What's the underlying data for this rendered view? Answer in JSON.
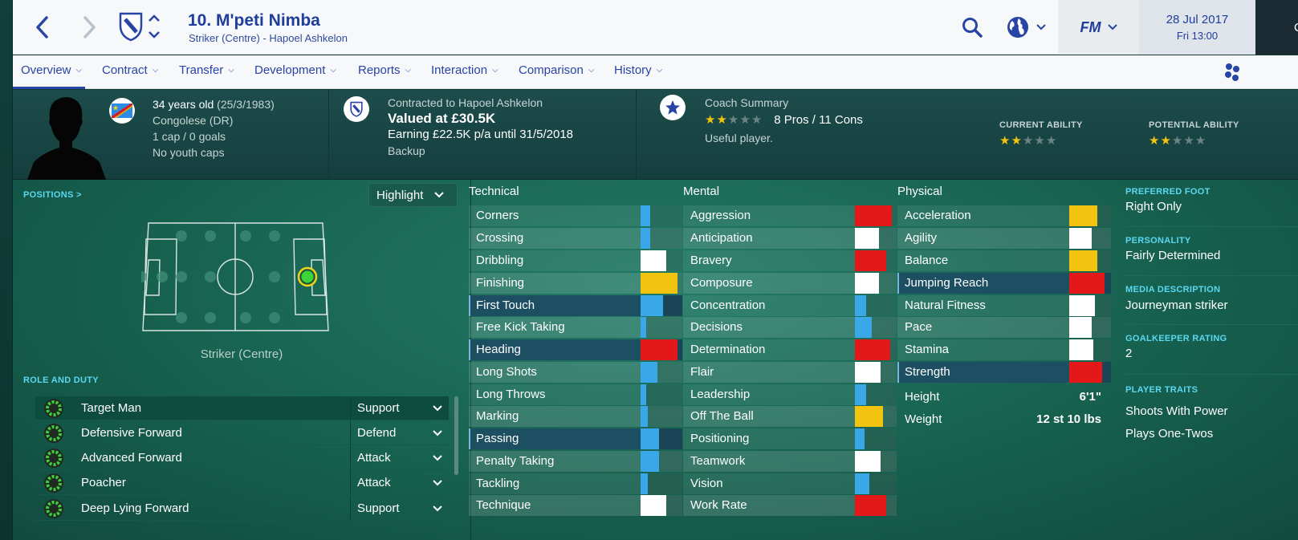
{
  "header": {
    "player_title": "10. M'peti Nimba",
    "player_subtitle": "Striker (Centre) - Hapoel Ashkelon",
    "logo_text": "FM",
    "date": "28 Jul 2017",
    "time": "Fri 13:00",
    "continue_label": "Co"
  },
  "tabs": [
    {
      "label": "Overview",
      "active": true
    },
    {
      "label": "Contract"
    },
    {
      "label": "Transfer"
    },
    {
      "label": "Development"
    },
    {
      "label": "Reports"
    },
    {
      "label": "Interaction"
    },
    {
      "label": "Comparison"
    },
    {
      "label": "History"
    }
  ],
  "profile": {
    "age_main": "34 years old",
    "age_dob": "(25/3/1983)",
    "nationality": "Congolese (DR)",
    "caps": "1 cap / 0 goals",
    "youth_caps": "No youth caps"
  },
  "contract": {
    "contracted_to": "Contracted to Hapoel Ashkelon",
    "value": "Valued at £30.5K",
    "earning": "Earning £22.5K p/a until 31/5/2018",
    "squad_status": "Backup"
  },
  "coach": {
    "label": "Coach Summary",
    "stars": 2,
    "stars_max": 5,
    "pros_cons": "8 Pros / 11 Cons",
    "summary": "Useful player."
  },
  "ability": {
    "current_label": "CURRENT ABILITY",
    "current_stars": 2,
    "potential_label": "POTENTIAL ABILITY",
    "potential_stars": 2,
    "stars_max": 5
  },
  "positions": {
    "label": "POSITIONS >",
    "highlight_label": "Highlight",
    "position_name": "Striker (Centre)"
  },
  "roles": {
    "label": "ROLE AND DUTY",
    "items": [
      {
        "name": "Target Man",
        "duty": "Support"
      },
      {
        "name": "Defensive Forward",
        "duty": "Defend"
      },
      {
        "name": "Advanced Forward",
        "duty": "Attack"
      },
      {
        "name": "Poacher",
        "duty": "Attack"
      },
      {
        "name": "Deep Lying Forward",
        "duty": "Support"
      }
    ]
  },
  "attributes": {
    "technical_label": "Technical",
    "mental_label": "Mental",
    "physical_label": "Physical",
    "technical": [
      {
        "name": "Corners",
        "level": 0.25,
        "color": "#3aa8e8"
      },
      {
        "name": "Crossing",
        "level": 0.25,
        "color": "#3aa8e8"
      },
      {
        "name": "Dribbling",
        "level": 0.7,
        "color": "#ffffff"
      },
      {
        "name": "Finishing",
        "level": 1.0,
        "color": "#f3c40f"
      },
      {
        "name": "First Touch",
        "level": 0.6,
        "color": "#3aa8e8",
        "highlight": true
      },
      {
        "name": "Free Kick Taking",
        "level": 0.15,
        "color": "#3aa8e8"
      },
      {
        "name": "Heading",
        "level": 1.0,
        "color": "#e41818",
        "highlight": true
      },
      {
        "name": "Long Shots",
        "level": 0.45,
        "color": "#3aa8e8"
      },
      {
        "name": "Long Throws",
        "level": 0.15,
        "color": "#3aa8e8"
      },
      {
        "name": "Marking",
        "level": 0.2,
        "color": "#3aa8e8"
      },
      {
        "name": "Passing",
        "level": 0.5,
        "color": "#3aa8e8",
        "highlight": true
      },
      {
        "name": "Penalty Taking",
        "level": 0.5,
        "color": "#3aa8e8"
      },
      {
        "name": "Tackling",
        "level": 0.2,
        "color": "#3aa8e8"
      },
      {
        "name": "Technique",
        "level": 0.7,
        "color": "#ffffff"
      }
    ],
    "mental": [
      {
        "name": "Aggression",
        "level": 1.0,
        "color": "#e41818"
      },
      {
        "name": "Anticipation",
        "level": 0.65,
        "color": "#ffffff"
      },
      {
        "name": "Bravery",
        "level": 0.85,
        "color": "#e41818"
      },
      {
        "name": "Composure",
        "level": 0.65,
        "color": "#ffffff"
      },
      {
        "name": "Concentration",
        "level": 0.3,
        "color": "#3aa8e8"
      },
      {
        "name": "Decisions",
        "level": 0.45,
        "color": "#3aa8e8"
      },
      {
        "name": "Determination",
        "level": 0.95,
        "color": "#e41818"
      },
      {
        "name": "Flair",
        "level": 0.7,
        "color": "#ffffff"
      },
      {
        "name": "Leadership",
        "level": 0.3,
        "color": "#3aa8e8"
      },
      {
        "name": "Off The Ball",
        "level": 0.75,
        "color": "#f3c40f"
      },
      {
        "name": "Positioning",
        "level": 0.25,
        "color": "#3aa8e8"
      },
      {
        "name": "Teamwork",
        "level": 0.7,
        "color": "#ffffff"
      },
      {
        "name": "Vision",
        "level": 0.4,
        "color": "#3aa8e8"
      },
      {
        "name": "Work Rate",
        "level": 0.85,
        "color": "#e41818"
      }
    ],
    "physical": [
      {
        "name": "Acceleration",
        "level": 0.75,
        "color": "#f3c40f"
      },
      {
        "name": "Agility",
        "level": 0.6,
        "color": "#ffffff"
      },
      {
        "name": "Balance",
        "level": 0.75,
        "color": "#f3c40f"
      },
      {
        "name": "Jumping Reach",
        "level": 0.95,
        "color": "#e41818",
        "highlight": true
      },
      {
        "name": "Natural Fitness",
        "level": 0.7,
        "color": "#ffffff"
      },
      {
        "name": "Pace",
        "level": 0.6,
        "color": "#ffffff"
      },
      {
        "name": "Stamina",
        "level": 0.65,
        "color": "#ffffff"
      },
      {
        "name": "Strength",
        "level": 0.9,
        "color": "#e41818",
        "highlight": true
      }
    ],
    "height_label": "Height",
    "height_value": "6'1\"",
    "weight_label": "Weight",
    "weight_value": "12 st 10 lbs"
  },
  "details": {
    "preferred_foot_label": "PREFERRED FOOT",
    "preferred_foot": "Right Only",
    "personality_label": "PERSONALITY",
    "personality": "Fairly Determined",
    "media_label": "MEDIA DESCRIPTION",
    "media": "Journeyman striker",
    "gk_label": "GOALKEEPER RATING",
    "gk_rating": "2",
    "traits_label": "PLAYER TRAITS",
    "traits": [
      "Shoots With Power",
      "Plays One-Twos"
    ]
  }
}
